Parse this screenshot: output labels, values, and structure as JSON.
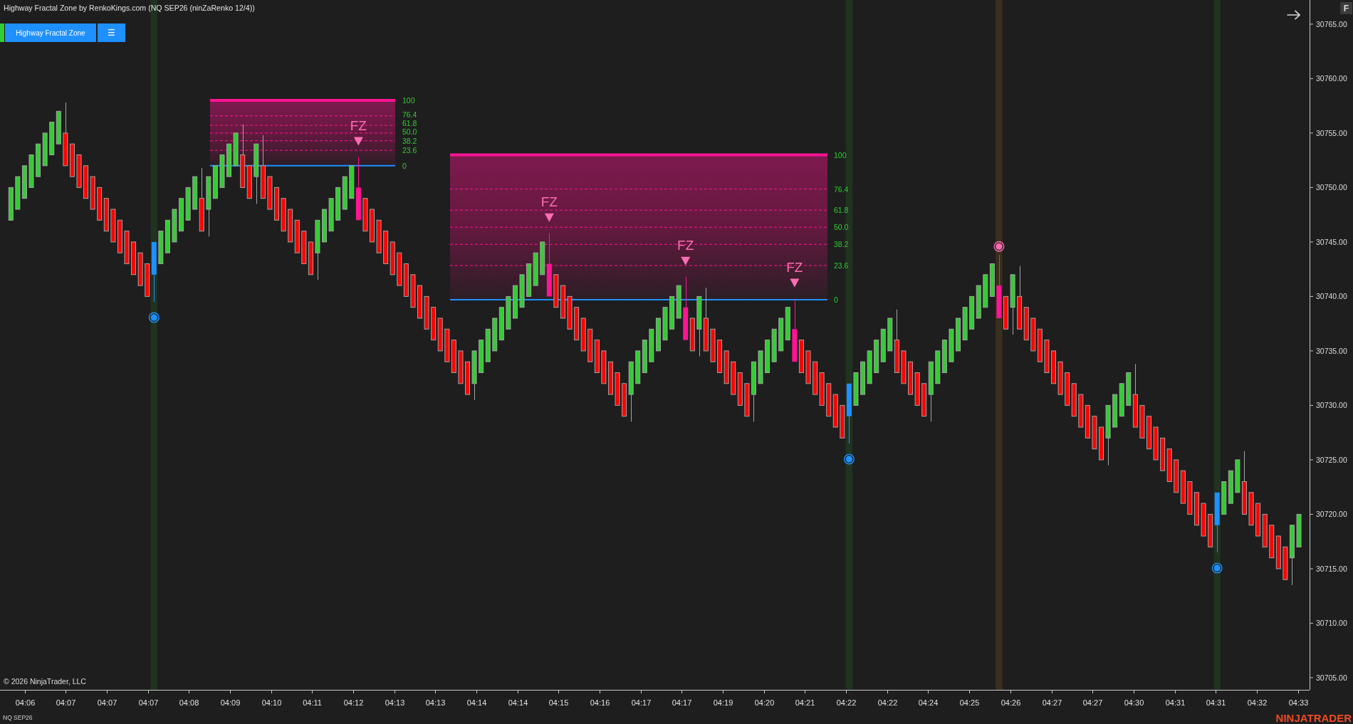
{
  "window": {
    "title": "Highway Fractal Zone by RenkoKings.com (NQ SEP26 (ninZaRenko 12/4))"
  },
  "toolbar": {
    "indicator_button": "Highway Fractal Zone",
    "menu_button": "☰"
  },
  "corner_button": "F",
  "chart": {
    "highlight_bands": [
      {
        "color": "#203220"
      },
      {
        "color": "#203220"
      },
      {
        "color": "#3a2f1c"
      },
      {
        "color": "#203220"
      }
    ],
    "fib_zones": [
      {
        "levels": [
          "100",
          "76.4",
          "61.8",
          "50.0",
          "38.2",
          "23.6",
          "0"
        ]
      },
      {
        "levels": [
          "100",
          "76.4",
          "61.8",
          "50.0",
          "38.2",
          "23.6",
          "0"
        ]
      }
    ],
    "signal_markers": [
      {
        "label": "FZ"
      },
      {
        "label": "FZ"
      },
      {
        "label": "FZ"
      },
      {
        "label": "FZ"
      }
    ],
    "signal_dots": [
      {
        "color": "#1e90ff"
      },
      {
        "color": "#1e90ff"
      },
      {
        "color": "#ff69b4"
      },
      {
        "color": "#1e90ff"
      }
    ],
    "copyright": "© 2026 NinjaTrader, LLC"
  },
  "price_axis": {
    "labels": [
      "30765.00",
      "30760.00",
      "30755.00",
      "30750.00",
      "30745.00",
      "30740.00",
      "30735.00",
      "30730.00",
      "30725.00",
      "30720.00",
      "30715.00",
      "30710.00",
      "30705.00"
    ]
  },
  "time_axis": {
    "labels": [
      "04:06",
      "04:07",
      "04:07",
      "04:07",
      "04:08",
      "04:09",
      "04:10",
      "04:11",
      "04:12",
      "04:13",
      "04:13",
      "04:14",
      "04:14",
      "04:15",
      "04:16",
      "04:17",
      "04:17",
      "04:19",
      "04:20",
      "04:21",
      "04:22",
      "04:22",
      "04:24",
      "04:25",
      "04:26",
      "04:27",
      "04:27",
      "04:30",
      "04:31",
      "04:31",
      "04:32",
      "04:33"
    ]
  },
  "status_bar": {
    "instrument": "NQ SEP26",
    "logo": "NINJATRADER"
  }
}
